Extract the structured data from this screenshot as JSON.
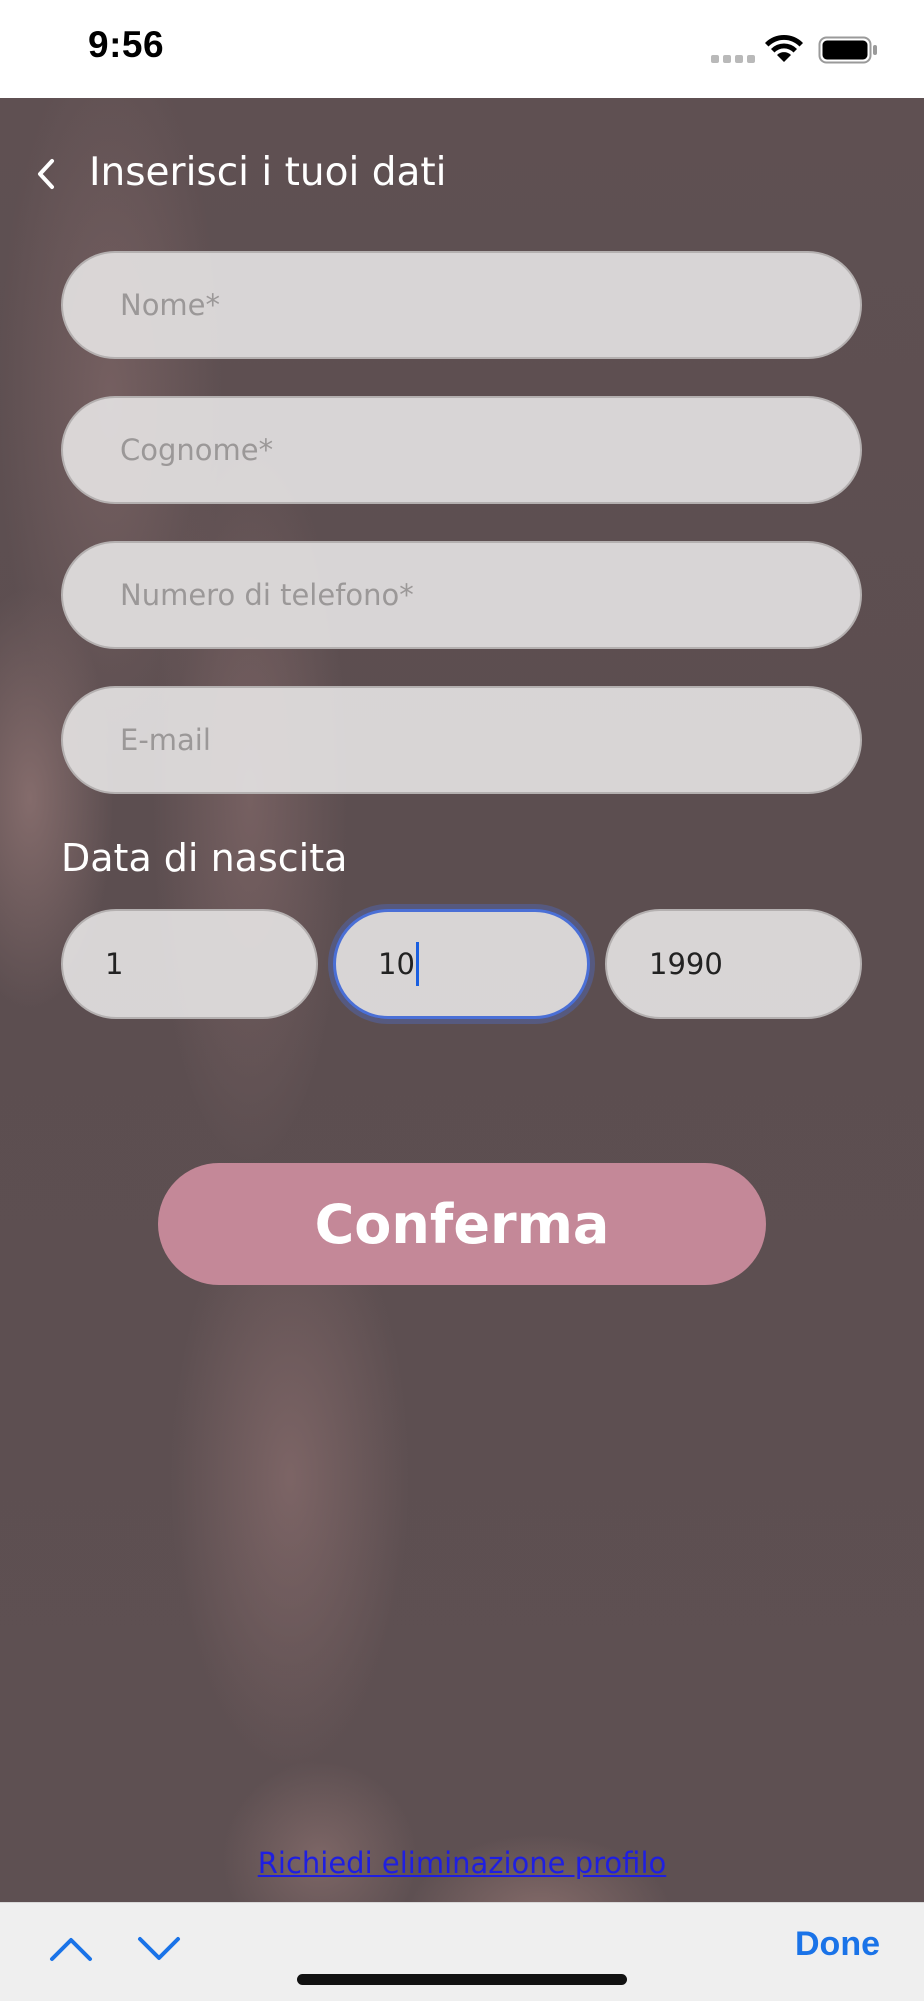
{
  "status_bar": {
    "time": "9:56"
  },
  "header": {
    "title": "Inserisci i tuoi dati",
    "back_icon": "chevron-left-icon"
  },
  "form": {
    "first_name": {
      "placeholder": "Nome*",
      "value": ""
    },
    "last_name": {
      "placeholder": "Cognome*",
      "value": ""
    },
    "phone": {
      "placeholder": "Numero di telefono*",
      "value": ""
    },
    "email": {
      "placeholder": "E-mail",
      "value": ""
    },
    "dob_label": "Data di nascita",
    "dob_day": "1",
    "dob_month": "10",
    "dob_year": "1990",
    "confirm_label": "Conferma"
  },
  "footer": {
    "delete_profile_link": "Richiedi eliminazione profilo"
  },
  "keyboard_toolbar": {
    "done_label": "Done",
    "prev_icon": "chevron-up-icon",
    "next_icon": "chevron-down-icon"
  },
  "colors": {
    "confirm_button": "#c48898",
    "link": "#1f1fe0",
    "done": "#1a73e8",
    "focus_ring": "#4a6fd6"
  }
}
